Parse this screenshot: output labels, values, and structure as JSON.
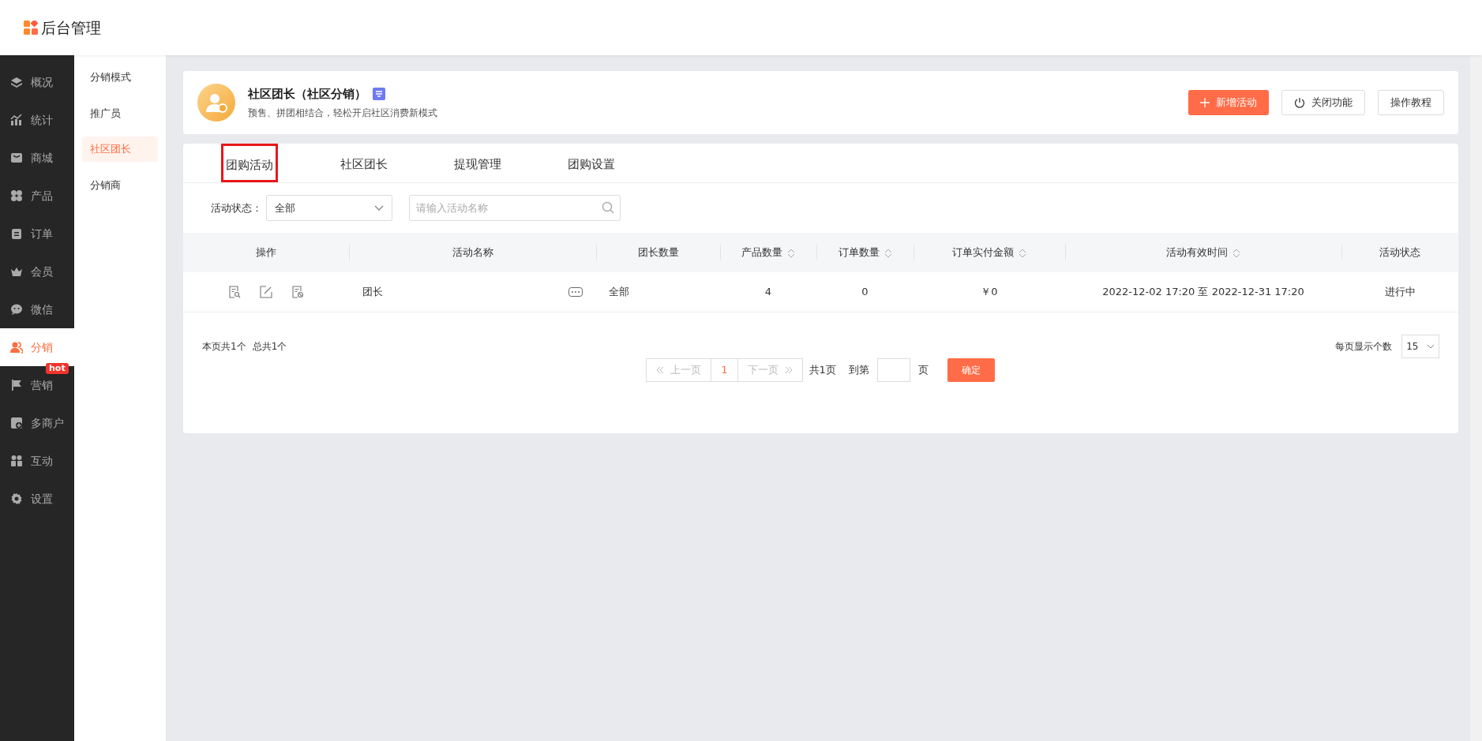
{
  "header": {
    "logo_text": "后台管理"
  },
  "main_nav": [
    {
      "label": "概况",
      "selected": false
    },
    {
      "label": "统计",
      "selected": false
    },
    {
      "label": "商城",
      "selected": false
    },
    {
      "label": "产品",
      "selected": false
    },
    {
      "label": "订单",
      "selected": false
    },
    {
      "label": "会员",
      "selected": false
    },
    {
      "label": "微信",
      "selected": false
    },
    {
      "label": "分销",
      "selected": true
    },
    {
      "label": "营销",
      "selected": false,
      "badge": "hot"
    },
    {
      "label": "多商户",
      "selected": false
    },
    {
      "label": "互动",
      "selected": false
    },
    {
      "label": "设置",
      "selected": false
    }
  ],
  "sub_nav": [
    {
      "label": "分销模式",
      "selected": false
    },
    {
      "label": "推广员",
      "selected": false
    },
    {
      "label": "社区团长",
      "selected": true
    },
    {
      "label": "分销商",
      "selected": false
    }
  ],
  "feature": {
    "title": "社区团长（社区分销）",
    "subtitle": "预售、拼团相结合，轻松开启社区消费新模式",
    "buttons": [
      {
        "label": "新增活动",
        "kind": "primary"
      },
      {
        "label": "关闭功能",
        "kind": "power"
      },
      {
        "label": "操作教程",
        "kind": "plain"
      }
    ]
  },
  "tabs": [
    {
      "label": "团购活动",
      "highlighted": true
    },
    {
      "label": "社区团长",
      "highlighted": false
    },
    {
      "label": "提现管理",
      "highlighted": false
    },
    {
      "label": "团购设置",
      "highlighted": false
    }
  ],
  "filter": {
    "label": "活动状态：",
    "status_value": "全部",
    "search_placeholder": "请输入活动名称"
  },
  "table": {
    "columns": [
      {
        "label": "操作",
        "sortable": false
      },
      {
        "label": "活动名称",
        "sortable": false
      },
      {
        "label": "团长数量",
        "sortable": false
      },
      {
        "label": "产品数量",
        "sortable": true
      },
      {
        "label": "订单数量",
        "sortable": true
      },
      {
        "label": "订单实付金额",
        "sortable": true
      },
      {
        "label": "活动有效时间",
        "sortable": true
      },
      {
        "label": "活动状态",
        "sortable": false
      }
    ],
    "rows": [
      {
        "name": "团长",
        "leaders": "全部",
        "products": "4",
        "orders": "0",
        "paid": "￥0",
        "period": "2022-12-02 17:20 至 2022-12-31 17:20",
        "status": "进行中"
      }
    ]
  },
  "footer": {
    "page_count": "本页共1个",
    "total_count": "总共1个",
    "page_size_label": "每页显示个数",
    "page_size": "15",
    "prev": {
      "label": "上一页",
      "disabled": true
    },
    "pages": [
      {
        "label": "1",
        "selected": true
      }
    ],
    "next": {
      "label": "下一页",
      "disabled": true
    },
    "total_pages": "共1页",
    "goto_label": "到第",
    "page_unit": "页",
    "confirm": "确定"
  }
}
